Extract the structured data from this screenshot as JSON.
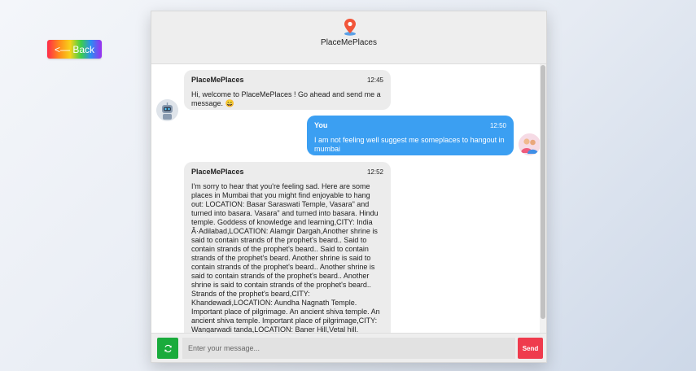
{
  "back_button": {
    "label": "<— Back"
  },
  "header": {
    "title": "PlaceMePlaces",
    "icon": "map-pin-icon"
  },
  "messages": [
    {
      "sender": "PlaceMePlaces",
      "time": "12:45",
      "text": "Hi, welcome to PlaceMePlaces ! Go ahead and send me a message. 😄",
      "avatar": "robot-avatar"
    },
    {
      "sender": "You",
      "time": "12:50",
      "text": "I am not feeling well suggest me someplaces to hangout in mumbai",
      "avatar": "user-avatar"
    },
    {
      "sender": "PlaceMePlaces",
      "time": "12:52",
      "text": "I'm sorry to hear that you're feeling sad. Here are some places in Mumbai that you might find enjoyable to hang out: LOCATION: Basar Saraswati Temple, Vasara\" and turned into basara. Vasara\" and turned into basara. Hindu temple. Goddess of knowledge and learning,CITY: India Â·Adilabad,LOCATION: Alamgir Dargah,Another shrine is said to contain strands of the prophet's beard.. Said to contain strands of the prophet's beard.. Said to contain strands of the prophet's beard. Another shrine is said to contain strands of the prophet's beard.. Another shrine is said to contain strands of the prophet's beard.. Another shrine is said to contain strands of the prophet's beard.. Strands of the prophet's beard,CITY: Khandewadi,LOCATION: Aundha Nagnath Temple. Important place of pilgrimage. An ancient shiva temple. An ancient shiva temple. Important place of pilgrimage,CITY: Wangarwadi tanda,LOCATION: Baner Hill,Vetal hill. Pashan area from the other.. One can view the whole of baner. One can view the whole of baner on one side. There",
      "avatar": "robot-avatar"
    }
  ],
  "input": {
    "placeholder": "Enter your message..."
  },
  "send_button": {
    "label": "Send"
  },
  "colors": {
    "user_bubble": "#3b9ff2",
    "bot_bubble": "#ececec",
    "send": "#ef3b4d",
    "refresh": "#1aab3c"
  }
}
